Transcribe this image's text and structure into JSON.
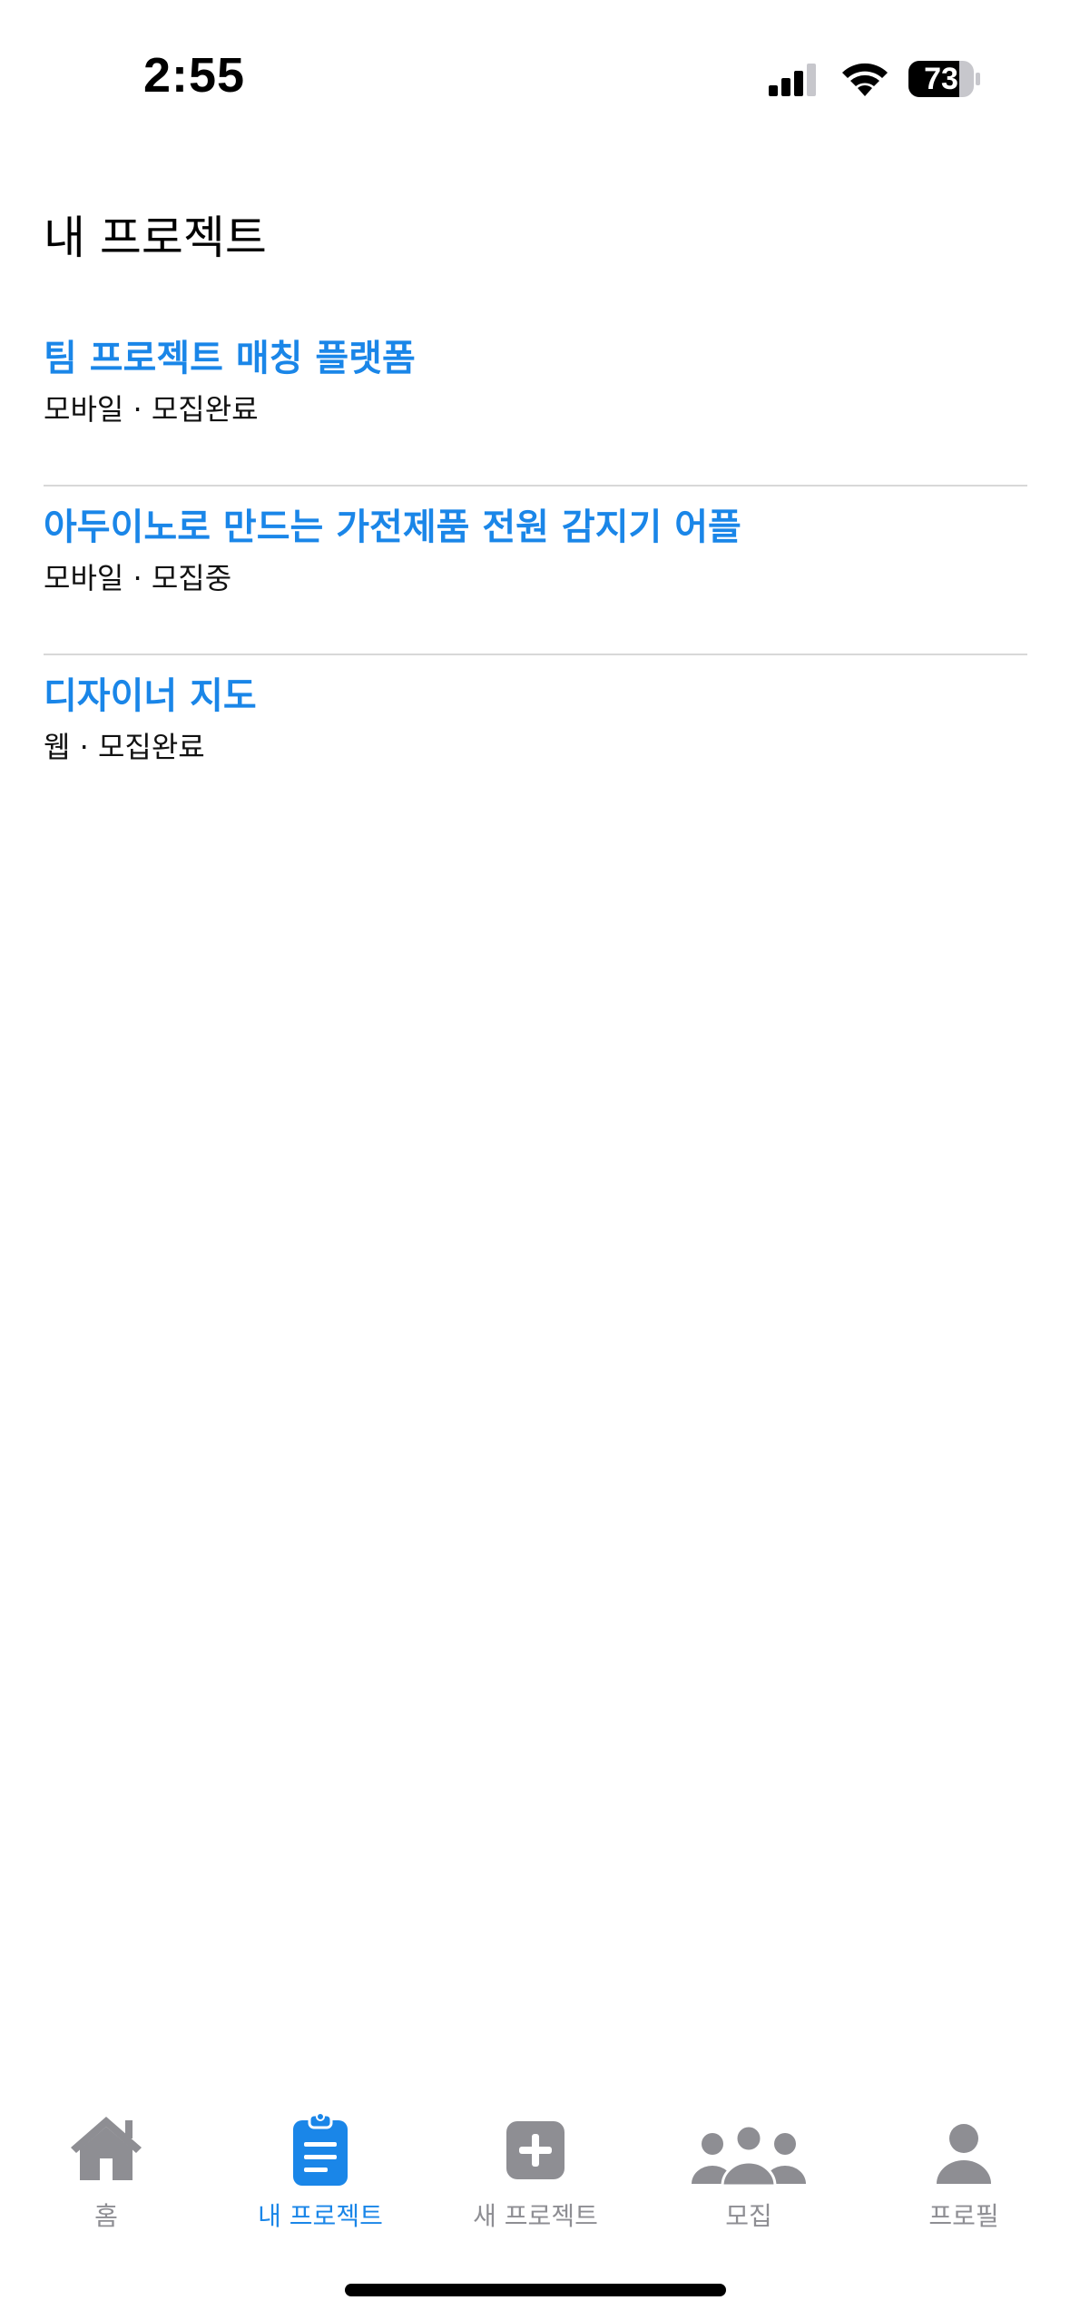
{
  "status_bar": {
    "time": "2:55",
    "battery": "73",
    "icons": [
      "cellular-signal-icon",
      "wifi-icon",
      "battery-icon"
    ]
  },
  "page": {
    "title": "내 프로젝트"
  },
  "projects": [
    {
      "title": "팀 프로젝트 매칭 플랫폼",
      "meta": "모바일 · 모집완료"
    },
    {
      "title": "아두이노로 만드는 가전제품 전원 감지기 어플",
      "meta": "모바일 · 모집중"
    },
    {
      "title": "디자이너 지도",
      "meta": "웹 · 모집완료"
    }
  ],
  "tab_bar": {
    "tabs": [
      {
        "label": "홈",
        "icon": "house-icon"
      },
      {
        "label": "내 프로젝트",
        "icon": "clipboard-icon",
        "active": true
      },
      {
        "label": "새 프로젝트",
        "icon": "plus-square-icon"
      },
      {
        "label": "모집",
        "icon": "people-icon"
      },
      {
        "label": "프로필",
        "icon": "person-icon"
      }
    ]
  },
  "colors": {
    "accent": "#1a86e8",
    "inactive": "#8e8e93",
    "divider": "#d8d8d8"
  }
}
